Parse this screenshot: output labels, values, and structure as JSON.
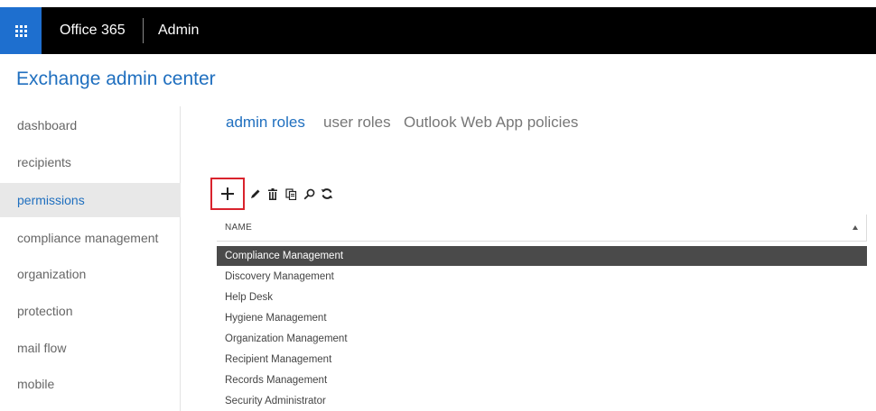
{
  "topbar": {
    "brand": "Office 365",
    "section": "Admin",
    "waffle_icon": "app-launcher-icon",
    "waffle_color": "#1e6fcf"
  },
  "app": {
    "title": "Exchange admin center",
    "accent": "#1f6fbf"
  },
  "sidebar": {
    "items": [
      {
        "label": "dashboard",
        "active": false
      },
      {
        "label": "recipients",
        "active": false
      },
      {
        "label": "permissions",
        "active": true
      },
      {
        "label": "compliance management",
        "active": false
      },
      {
        "label": "organization",
        "active": false
      },
      {
        "label": "protection",
        "active": false
      },
      {
        "label": "mail flow",
        "active": false
      },
      {
        "label": "mobile",
        "active": false
      }
    ]
  },
  "tabs": [
    {
      "label": "admin roles",
      "active": true
    },
    {
      "label": "user roles",
      "active": false
    },
    {
      "label": "Outlook Web App policies",
      "active": false
    }
  ],
  "toolbar": {
    "buttons": [
      {
        "name": "add",
        "icon": "plus-icon",
        "highlighted": true,
        "highlight_color": "#d9232d"
      },
      {
        "name": "edit",
        "icon": "pencil-icon"
      },
      {
        "name": "delete",
        "icon": "trash-icon"
      },
      {
        "name": "copy",
        "icon": "copy-icon"
      },
      {
        "name": "search",
        "icon": "search-icon"
      },
      {
        "name": "refresh",
        "icon": "refresh-icon"
      }
    ]
  },
  "grid": {
    "column_name": "NAME",
    "sort": "ascending",
    "rows": [
      {
        "name": "Compliance Management",
        "selected": true
      },
      {
        "name": "Discovery Management",
        "selected": false
      },
      {
        "name": "Help Desk",
        "selected": false
      },
      {
        "name": "Hygiene Management",
        "selected": false
      },
      {
        "name": "Organization Management",
        "selected": false
      },
      {
        "name": "Recipient Management",
        "selected": false
      },
      {
        "name": "Records Management",
        "selected": false
      },
      {
        "name": "Security Administrator",
        "selected": false
      }
    ]
  }
}
